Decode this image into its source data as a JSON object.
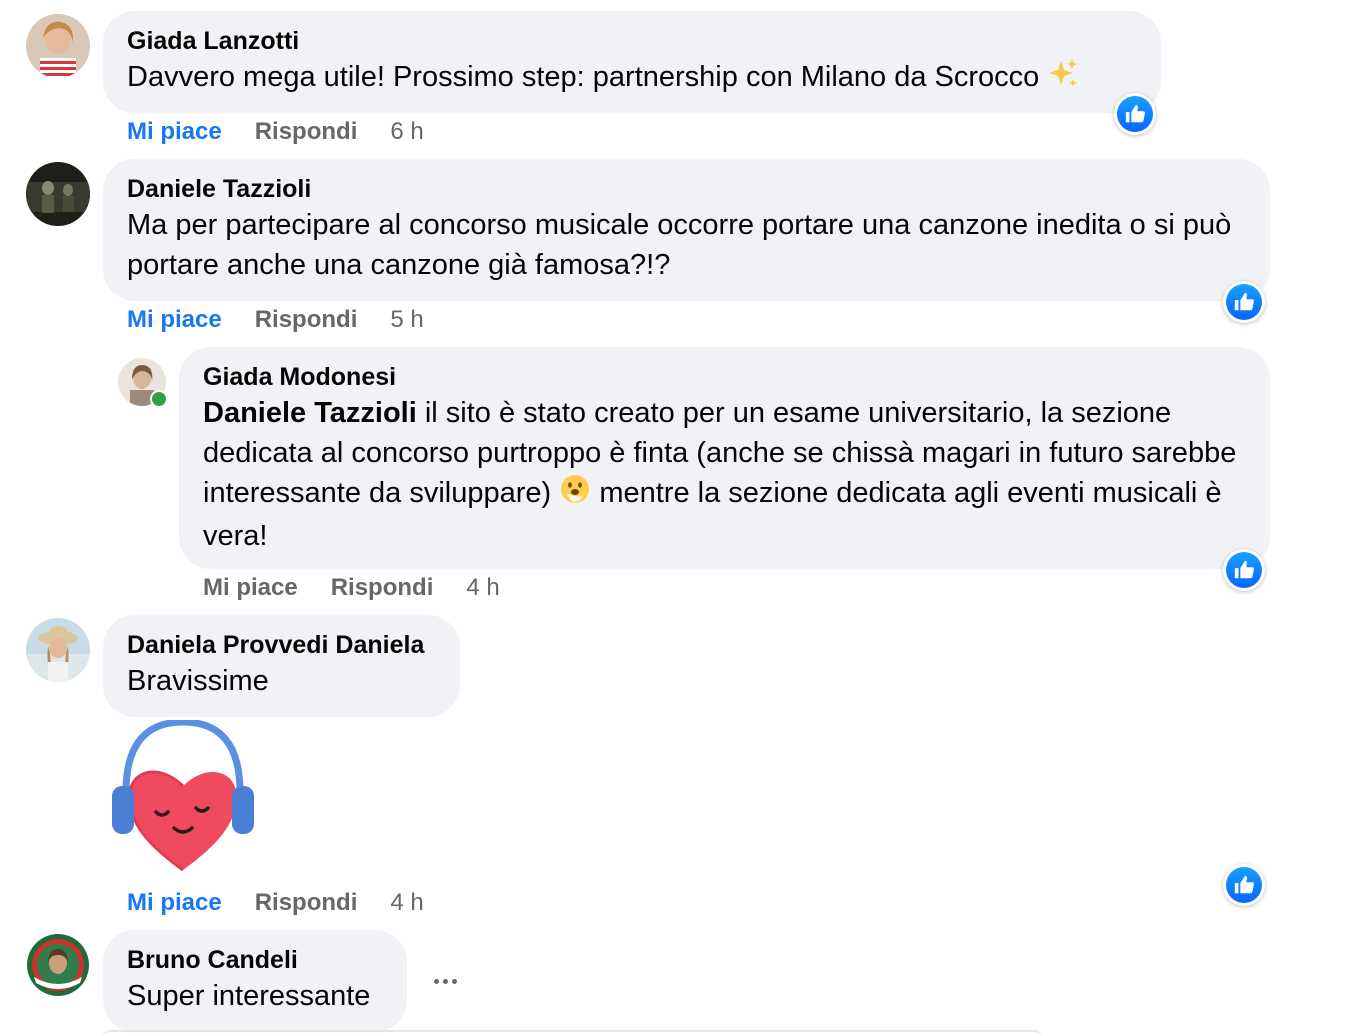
{
  "actions": {
    "like": "Mi piace",
    "reply": "Rispondi"
  },
  "comments": [
    {
      "author": "Giada Lanzotti",
      "text": "Davvero mega utile! Prossimo step: partnership con Milano da Scrocco",
      "time": "6 h",
      "liked": true
    },
    {
      "author": "Daniele Tazzioli",
      "text": "Ma per partecipare al concorso musicale occorre portare una canzone inedita o si può portare anche una canzone già famosa?!?",
      "time": "5 h",
      "liked": true
    },
    {
      "author": "Giada Modonesi",
      "mention": "Daniele Tazzioli",
      "text_before_emoji": " il sito è stato creato per un esame universitario, la sezione dedicata al concorso purtroppo è finta (anche se chissà magari in futuro sarebbe interessante da sviluppare)",
      "text_after_emoji": " mentre la sezione dedicata agli eventi musicali è vera!",
      "time": "4 h",
      "liked": false
    },
    {
      "author": "Daniela Provvedi Daniela",
      "text": "Bravissime",
      "time": "4 h",
      "liked": true
    },
    {
      "author": "Bruno Candeli",
      "text": "Super interessante"
    }
  ],
  "colors": {
    "like_active": "#1877f2",
    "meta_gray": "#65676b",
    "bubble_bg": "#f0f2f5",
    "online_dot": "#31a24c"
  },
  "icons": {
    "reaction": "like-thumb-icon",
    "sparkles": "sparkles-emoji",
    "sticker": "heart-headphones-sticker",
    "shushing": "hand-over-mouth-emoji",
    "more": "more-options-icon"
  }
}
